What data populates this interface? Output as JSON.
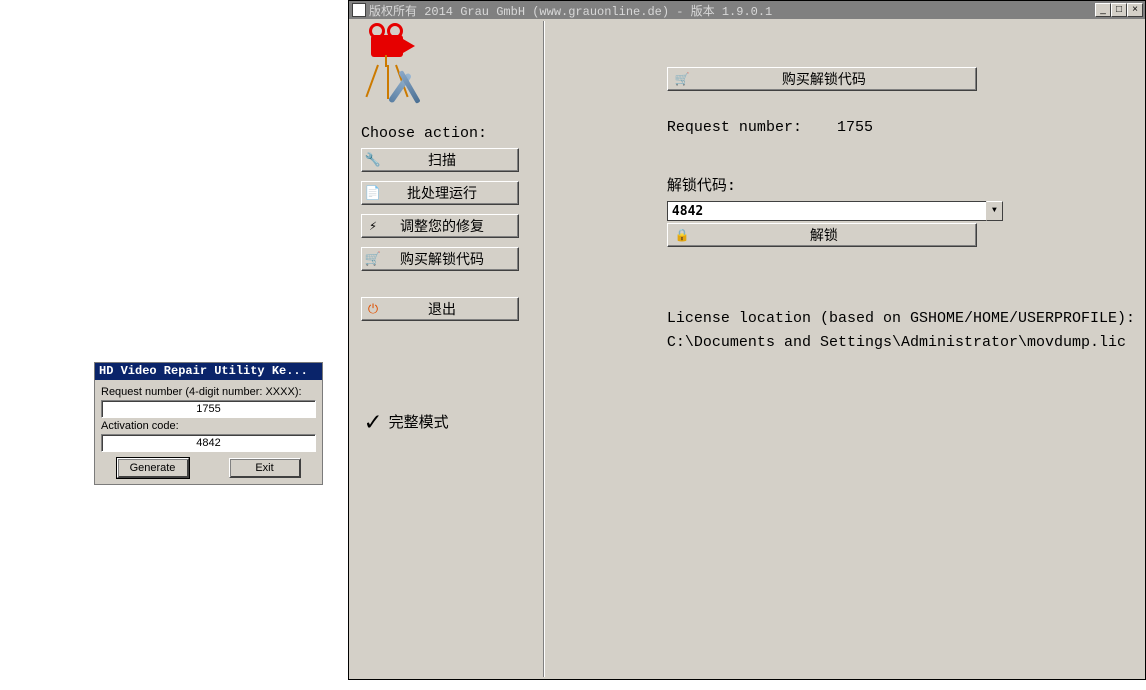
{
  "keygen": {
    "title": "HD Video Repair Utility Ke...",
    "request_label": "Request number (4-digit number: XXXX):",
    "request_value": "1755",
    "activation_label": "Activation code:",
    "activation_value": "4842",
    "generate_btn": "Generate",
    "exit_btn": "Exit"
  },
  "main": {
    "title": "版权所有 2014 Grau GmbH (www.grauonline.de) - 版本 1.9.0.1",
    "choose_action_label": "Choose action:",
    "actions": {
      "scan": "扫描",
      "batch": "批处理运行",
      "adjust": "调整您的修复",
      "buy": "购买解锁代码",
      "exit": "退出"
    },
    "full_mode": "完整模式",
    "buy_unlock_btn": "购买解锁代码",
    "request_number_label": "Request number:",
    "request_number_value": "1755",
    "unlock_code_label": "解锁代码:",
    "unlock_code_value": "4842",
    "unlock_btn": "解锁",
    "license_line1": "License location (based on GSHOME/HOME/USERPROFILE):",
    "license_line2": "C:\\Documents and Settings\\Administrator\\movdump.lic"
  },
  "icons": {
    "wrench": "🔧",
    "doc": "📄",
    "bolt": "⚡",
    "cart": "🛒",
    "power": "⏻",
    "lock": "🔒",
    "dropdown": "▼"
  }
}
